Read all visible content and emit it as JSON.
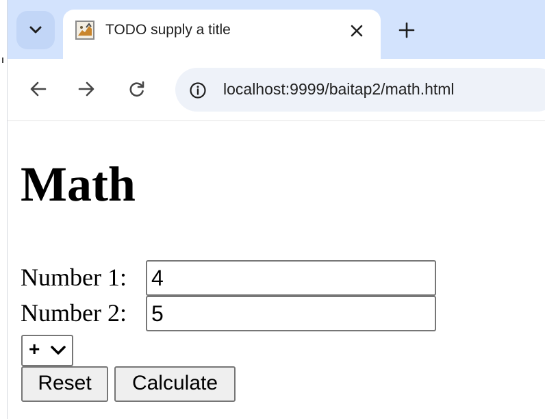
{
  "browser": {
    "tab": {
      "title": "TODO supply a title",
      "favicon": "cat-favicon-icon"
    },
    "toolbar": {
      "back_icon": "back-arrow-icon",
      "forward_icon": "forward-arrow-icon",
      "reload_icon": "reload-icon",
      "site_info_icon": "info-icon",
      "url": "localhost:9999/baitap2/math.html"
    },
    "colors": {
      "tab_strip": "#d3e3fd",
      "omnibox": "#eef2f9"
    }
  },
  "page": {
    "heading": "Math",
    "number1": {
      "label": "Number 1:",
      "value": "4"
    },
    "number2": {
      "label": "Number 2:",
      "value": "5"
    },
    "operator": {
      "selected": "+"
    },
    "buttons": {
      "reset": "Reset",
      "calculate": "Calculate"
    }
  }
}
